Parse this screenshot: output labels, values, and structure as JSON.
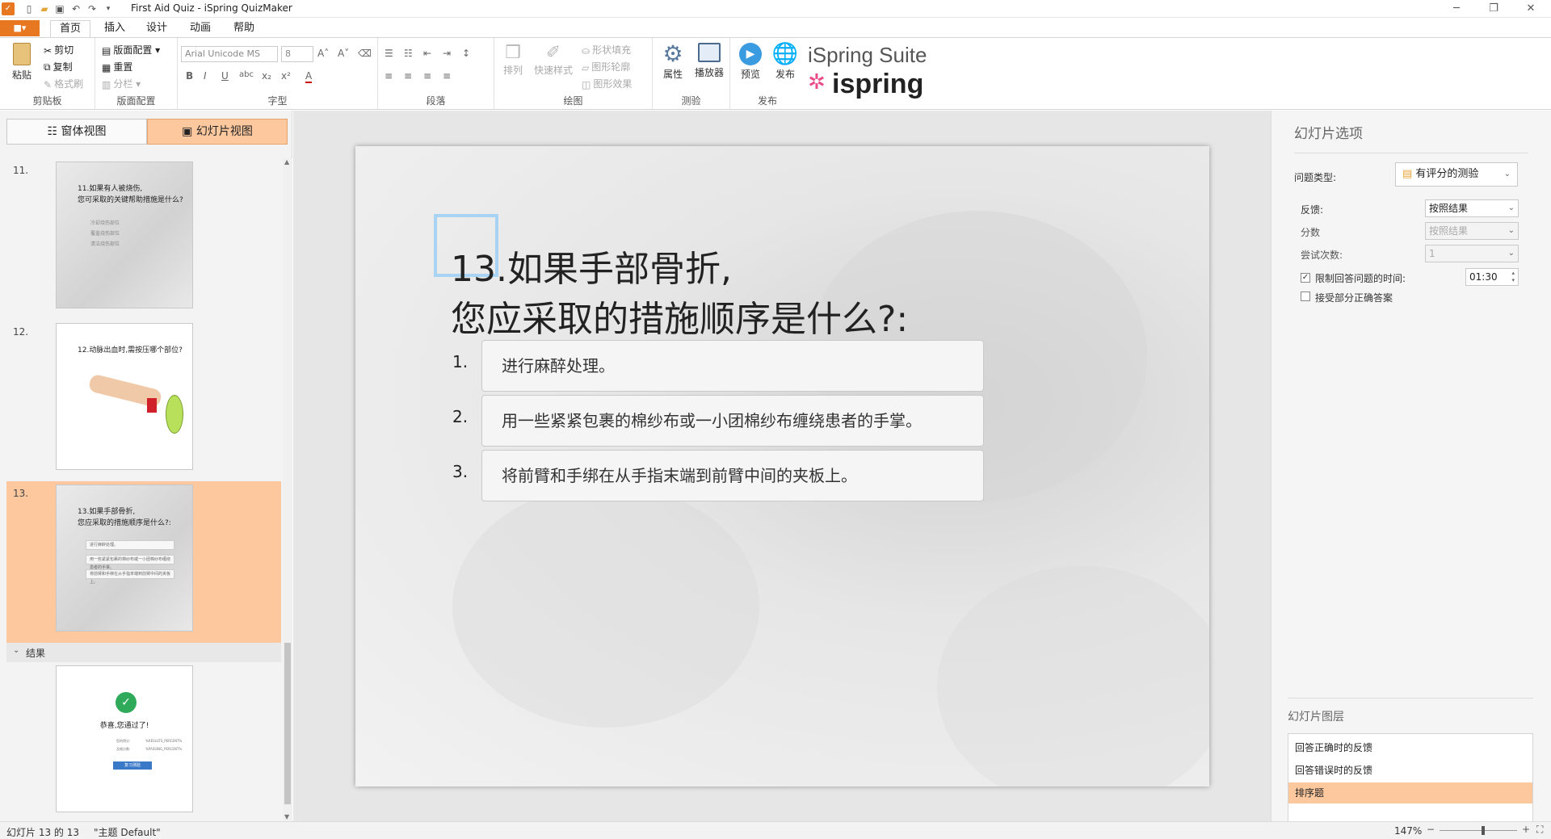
{
  "app": {
    "title": "First Aid Quiz - iSpring QuizMaker"
  },
  "tabs": {
    "file": "■▾",
    "home": "首页",
    "insert": "插入",
    "design": "设计",
    "animation": "动画",
    "help": "帮助"
  },
  "ribbon": {
    "clipboard": {
      "paste": "粘贴",
      "cut": "剪切",
      "copy": "复制",
      "format_painter": "格式刷",
      "label": "剪贴板"
    },
    "layout": {
      "layout": "版面配置",
      "reset": "重置",
      "section": "分栏",
      "label": "版面配置"
    },
    "font": {
      "family": "Arial Unicode MS",
      "size": "8",
      "label": "字型"
    },
    "paragraph": {
      "label": "段落"
    },
    "drawing": {
      "arrange": "排列",
      "quick_styles": "快速样式",
      "shape_fill": "形状填充",
      "shape_outline": "图形轮廓",
      "shape_effects": "图形效果",
      "label": "绘图"
    },
    "quiz": {
      "properties": "属性",
      "player": "播放器",
      "label": "测验"
    },
    "publish": {
      "preview": "预览",
      "publish": "发布",
      "label": "发布"
    },
    "brand": {
      "suite": "iSpring Suite",
      "logo": "ispring"
    }
  },
  "left": {
    "form_view": "窗体视图",
    "slide_view": "幻灯片视图",
    "section_results": "结果",
    "slides": [
      {
        "num": "11.",
        "title_l1": "11.如果有人被烧伤,",
        "title_l2": "您可采取的关键帮助措施是什么?",
        "opts": [
          "冷却烧伤部位",
          "覆盖烧伤部位",
          "清洁烧伤部位"
        ]
      },
      {
        "num": "12.",
        "title_l1": "12.动脉出血时,需按压哪个部位?"
      },
      {
        "num": "13.",
        "title_l1": "13.如果手部骨折,",
        "title_l2": "您应采取的措施顺序是什么?:",
        "opts": [
          "进行麻醉处理。",
          "用一些紧紧包裹的棉纱布或一小团棉纱布缠绕患者的手掌。",
          "将前臂和手绑在从手指末端到前臂中间的夹板上。"
        ]
      }
    ],
    "result": {
      "title": "恭喜,您通过了!",
      "row1_label": "您的得分:",
      "row1_value": "%RESULTS_PERCENT%",
      "row2_label": "及格分数:",
      "row2_value": "%PASSING_PERCENT%",
      "button": "复习测验"
    }
  },
  "slide": {
    "title_l1": "13.如果手部骨折,",
    "title_l2": "您应采取的措施顺序是什么?:",
    "answers": [
      {
        "num": "1.",
        "text": "进行麻醉处理。"
      },
      {
        "num": "2.",
        "text": "用一些紧紧包裹的棉纱布或一小团棉纱布缠绕患者的手掌。"
      },
      {
        "num": "3.",
        "text": "将前臂和手绑在从手指末端到前臂中间的夹板上。"
      }
    ]
  },
  "right": {
    "title": "幻灯片选项",
    "question_type_label": "问题类型:",
    "question_type": "有评分的测验",
    "feedback_label": "反馈:",
    "feedback": "按照结果",
    "score_label": "分数",
    "score": "按照结果",
    "attempts_label": "尝试次数:",
    "attempts": "1",
    "time_limit_label": "限制回答问题的时间:",
    "time_limit": "01:30",
    "partial_label": "接受部分正确答案",
    "layers_title": "幻灯片图层",
    "layers": [
      "回答正确时的反馈",
      "回答错误时的反馈",
      "排序题"
    ]
  },
  "status": {
    "slide_count": "幻灯片 13 的 13",
    "theme": "\"主题 Default\"",
    "zoom": "147%"
  }
}
